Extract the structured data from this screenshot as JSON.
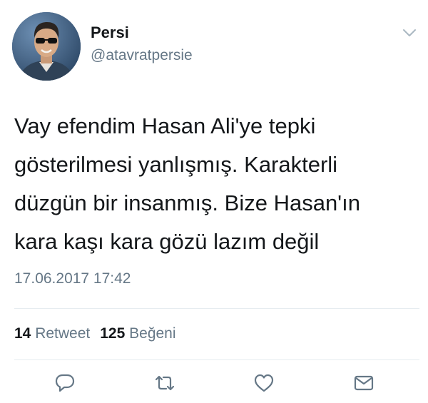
{
  "author": {
    "name": "Persi",
    "handle": "@atavratpersie"
  },
  "tweet": {
    "lines": [
      "Vay efendim Hasan Ali'ye tepki",
      "gösterilmesi yanlışmış. Karakterli",
      "düzgün bir insanmış. Bize Hasan'ın",
      "kara kaşı kara gözü lazım değil"
    ],
    "timestamp": "17.06.2017 17:42"
  },
  "stats": {
    "retweet_count": "14",
    "retweet_label": "Retweet",
    "like_count": "125",
    "like_label": "Beğeni"
  },
  "icons": {
    "more": "chevron-down-icon",
    "reply": "reply-icon",
    "retweet": "retweet-icon",
    "like": "heart-icon",
    "message": "envelope-icon"
  },
  "colors": {
    "text": "#14171a",
    "secondary": "#657786",
    "divider": "#e6ecf0"
  }
}
